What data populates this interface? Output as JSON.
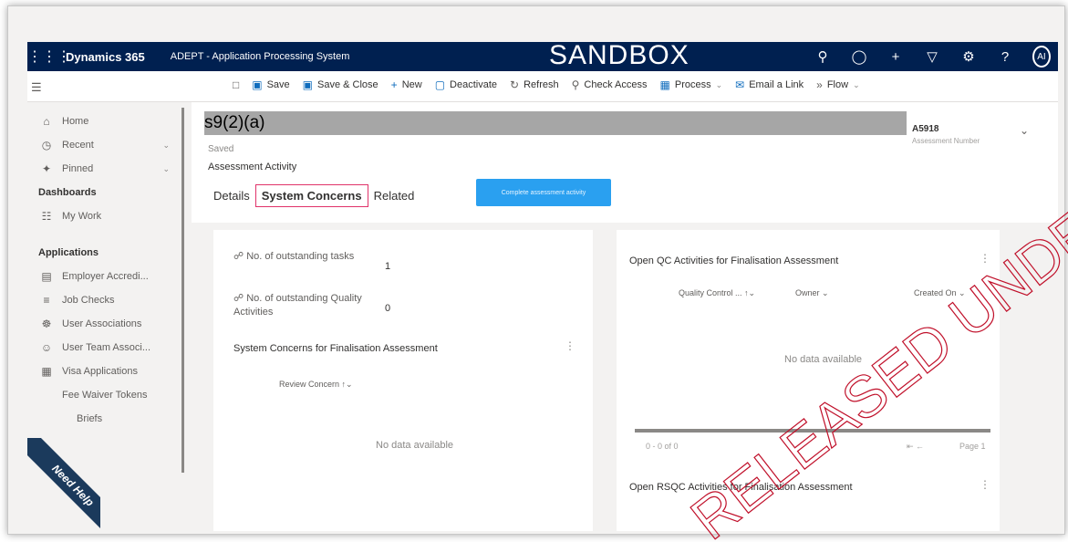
{
  "topnav": {
    "brand": "Dynamics 365",
    "app_name": "ADEPT - Application Processing System",
    "environment_banner": "SANDBOX",
    "avatar_initials": "AI",
    "icons": [
      "search-icon",
      "lightbulb-icon",
      "plus-icon",
      "filter-icon",
      "gear-icon",
      "help-icon"
    ]
  },
  "commandbar": {
    "save": "Save",
    "save_close": "Save & Close",
    "new": "New",
    "deactivate": "Deactivate",
    "refresh": "Refresh",
    "check_access": "Check Access",
    "process": "Process",
    "email_link": "Email a Link",
    "flow": "Flow"
  },
  "sidebar": {
    "home": "Home",
    "recent": "Recent",
    "pinned": "Pinned",
    "dashboards_header": "Dashboards",
    "my_work": "My Work",
    "applications_header": "Applications",
    "items": [
      "Employer Accredi...",
      "Job Checks",
      "User Associations",
      "User Team Associ...",
      "Visa Applications",
      "Fee Waiver Tokens",
      "Briefs"
    ],
    "need_help": "Need Help"
  },
  "record": {
    "title": "s9(2)(a)",
    "status": "Saved",
    "entity": "Assessment Activity",
    "assessment_number": "A5918",
    "assessment_number_label": "Assessment Number",
    "complete_button": "Complete assessment activity"
  },
  "tabs": [
    "Details",
    "System Concerns",
    "Related"
  ],
  "left_panel": {
    "field1_label": "No. of outstanding tasks",
    "field1_value": "1",
    "field2_label": "No. of outstanding Quality Activities",
    "field2_value": "0",
    "section_title": "System Concerns for Finalisation Assessment",
    "grid_column": "Review Concern",
    "no_data": "No data available"
  },
  "right_panel": {
    "section_title": "Open QC Activities for Finalisation Assessment",
    "columns": [
      "Quality Control ...",
      "Owner",
      "Created On"
    ],
    "no_data": "No data available",
    "pager_count": "0 - 0 of 0",
    "pager_page": "Page 1",
    "section2_title": "Open RSQC Activities for Finalisation Assessment"
  },
  "watermark_text": "RELEASED UNDER THE OFFICIAL INFORMATION ACT"
}
